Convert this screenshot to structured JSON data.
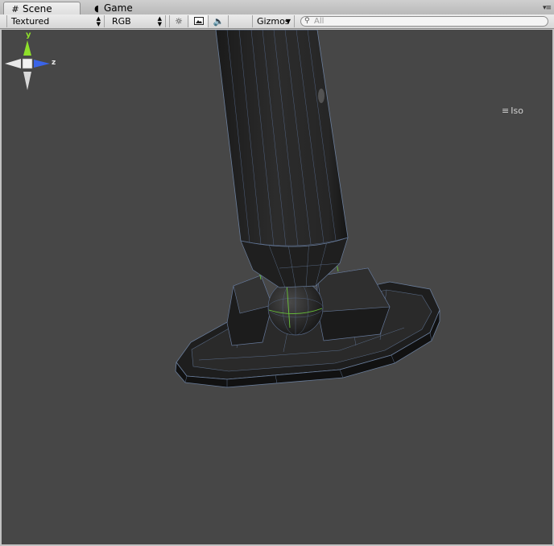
{
  "tabs": [
    {
      "label": "Scene",
      "icon": "grid-icon",
      "active": true
    },
    {
      "label": "Game",
      "icon": "pacman-icon",
      "active": false
    }
  ],
  "tab_menu_icon": "tab-options-icon",
  "toolbar": {
    "draw_mode": "Textured",
    "render_mode": "RGB",
    "lighting_icon": "sun-icon",
    "fx_icon": "image-icon",
    "audio_icon": "speaker-icon",
    "gizmos_label": "Gizmos",
    "search_placeholder": "All"
  },
  "gizmo": {
    "y_label": "y",
    "z_label": "z",
    "y_color": "#8ee02a",
    "z_color": "#3a64e8"
  },
  "projection_label": "Iso",
  "viewport_background": "#474747"
}
